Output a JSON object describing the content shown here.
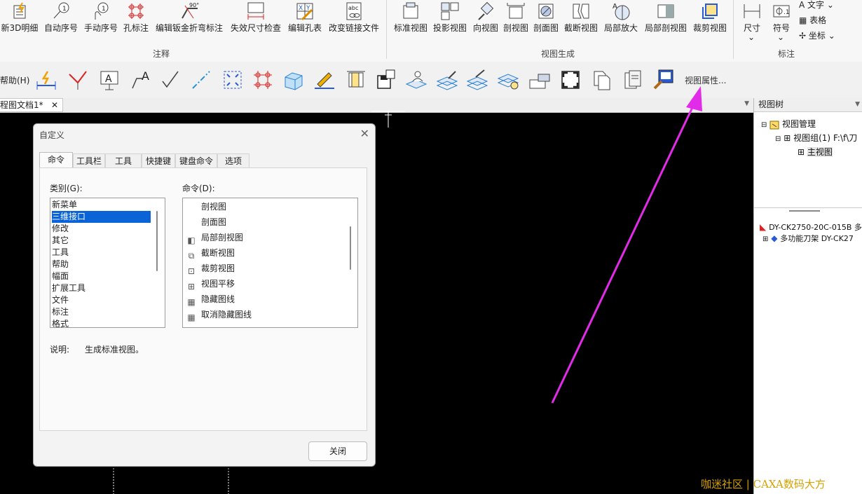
{
  "ribbon": {
    "annotation_buttons": [
      {
        "label": "新3D明细",
        "icon": "bom-icon"
      },
      {
        "label": "自动序号",
        "icon": "auto-balloon-icon"
      },
      {
        "label": "手动序号",
        "icon": "manual-balloon-icon"
      },
      {
        "label": "孔标注",
        "icon": "hole-callout-icon"
      },
      {
        "label": "编辑钣金折弯标注",
        "icon": "bend-note-icon"
      },
      {
        "label": "失效尺寸检查",
        "icon": "dimension-check-icon"
      },
      {
        "label": "编辑孔表",
        "icon": "hole-table-icon"
      },
      {
        "label": "改变链接文件",
        "icon": "change-link-icon"
      }
    ],
    "annotation_group": "注释",
    "view_buttons": [
      {
        "label": "标准视图",
        "icon": "standard-view-icon"
      },
      {
        "label": "投影视图",
        "icon": "projection-view-icon"
      },
      {
        "label": "向视图",
        "icon": "direction-view-icon"
      },
      {
        "label": "剖视图",
        "icon": "section-view-icon"
      },
      {
        "label": "剖面图",
        "icon": "cross-section-icon"
      },
      {
        "label": "截断视图",
        "icon": "break-view-icon"
      },
      {
        "label": "局部放大",
        "icon": "detail-view-icon"
      },
      {
        "label": "局部剖视图",
        "icon": "partial-section-icon"
      },
      {
        "label": "裁剪视图",
        "icon": "crop-view-icon"
      }
    ],
    "view_group": "视图生成",
    "mark_buttons": [
      {
        "label": "尺寸",
        "icon": "dimension-icon"
      },
      {
        "label": "符号",
        "icon": "symbol-icon"
      }
    ],
    "mark_small": [
      "文字",
      "表格",
      "坐标"
    ],
    "mark_group": "标注"
  },
  "toolbar2": {
    "help_label": "帮助(H)",
    "view_props_label": "视图属性..."
  },
  "document_tab": {
    "label": "程图文档1*"
  },
  "view_tree": {
    "title": "视图树",
    "nodes": [
      "视图管理",
      "视图组(1)",
      "F:\\f\\刀",
      "主视图"
    ],
    "lower_nodes": [
      "DY-CK2750-20C-015B 多功",
      "多功能刀架 DY-CK27"
    ]
  },
  "dialog": {
    "title": "自定义",
    "tabs": [
      "命令",
      "工具栏",
      "工具",
      "快捷键",
      "键盘命令",
      "选项"
    ],
    "category_label": "类别(G):",
    "categories": [
      "新菜单",
      "三维接口",
      "修改",
      "其它",
      "工具",
      "帮助",
      "幅面",
      "扩展工具",
      "文件",
      "标注",
      "格式"
    ],
    "selected_category": 1,
    "command_label": "命令(D):",
    "commands": [
      "剖视图",
      "剖面图",
      "局部剖视图",
      "截断视图",
      "裁剪视图",
      "视图平移",
      "隐藏图线",
      "取消隐藏图线"
    ],
    "description_label": "说明:",
    "description": "生成标准视图。",
    "close_label": "关闭"
  },
  "watermark": "咖迷社区 | CAXA数码大方",
  "colors": {
    "arrow": "#e22be8",
    "selection": "#0a64d8",
    "canvas": "#000000"
  }
}
